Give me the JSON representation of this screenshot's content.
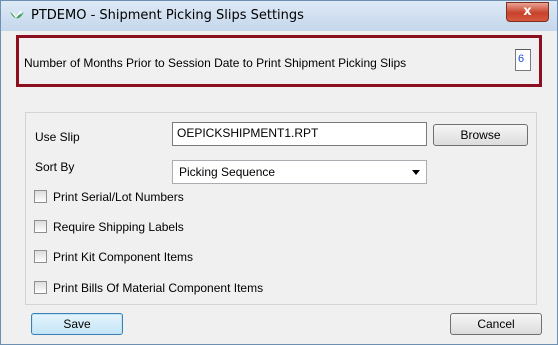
{
  "window": {
    "title": "PTDEMO - Shipment Picking Slips Settings",
    "close_glyph": "x"
  },
  "months": {
    "label": "Number of Months Prior to Session Date to Print Shipment Picking Slips",
    "value": "6"
  },
  "slip": {
    "label": "Use Slip",
    "value": "OEPICKSHIPMENT1.RPT",
    "browse_label": "Browse"
  },
  "sort": {
    "label": "Sort By",
    "selected": "Picking Sequence"
  },
  "options": [
    {
      "label": "Print Serial/Lot Numbers",
      "checked": false
    },
    {
      "label": "Require Shipping Labels",
      "checked": false
    },
    {
      "label": "Print Kit Component Items",
      "checked": false
    },
    {
      "label": "Print Bills Of Material Component Items",
      "checked": false
    }
  ],
  "buttons": {
    "save_label": "Save",
    "cancel_label": "Cancel"
  },
  "colors": {
    "highlight_border": "#8b0f1f",
    "app_icon": "#3da35a"
  }
}
